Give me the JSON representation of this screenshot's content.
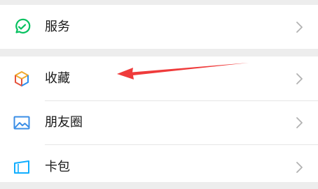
{
  "menu": {
    "services": {
      "label": "服务",
      "icon": "service-check-icon"
    },
    "favorites": {
      "label": "收藏",
      "icon": "cube-icon"
    },
    "moments": {
      "label": "朋友圈",
      "icon": "image-icon"
    },
    "cards": {
      "label": "卡包",
      "icon": "card-holder-icon"
    }
  },
  "colors": {
    "background": "#ededed",
    "row": "#ffffff",
    "text": "#191919",
    "chevron": "#b2b2b2",
    "service_green": "#07c160",
    "moments_blue": "#3a8ee6",
    "card_blue": "#10aeff",
    "annotation_arrow": "#ef3b3b"
  },
  "annotation": {
    "type": "arrow",
    "points_to": "favorites"
  }
}
